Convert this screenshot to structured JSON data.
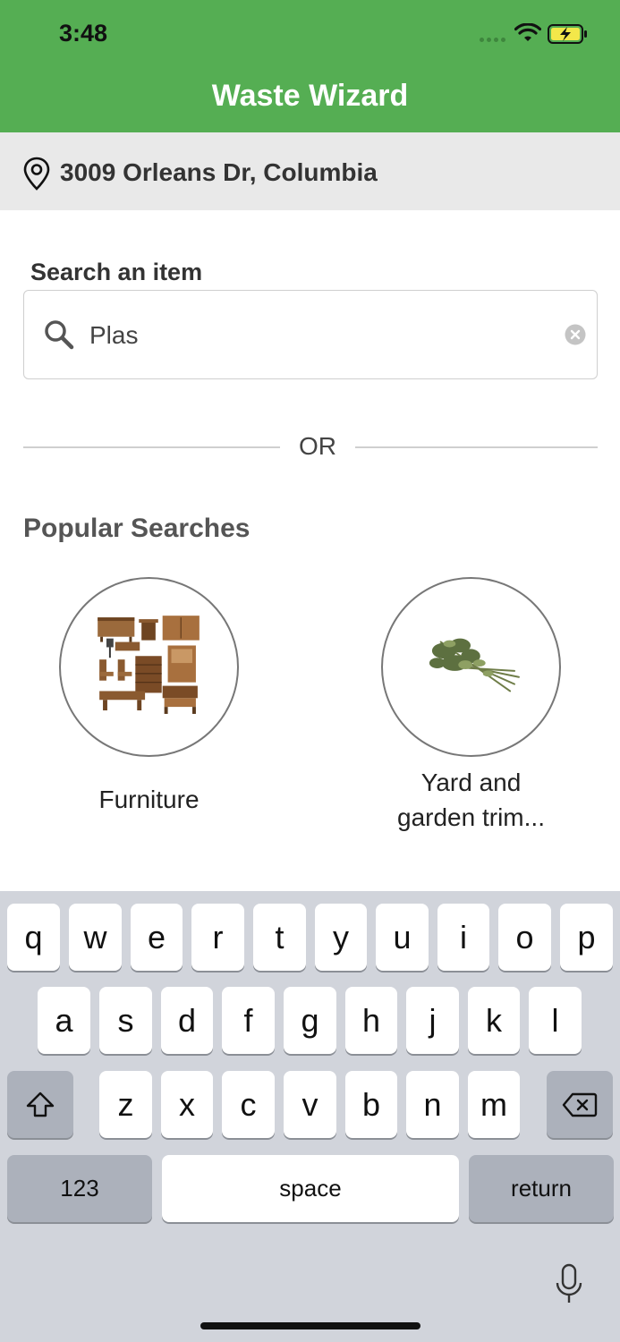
{
  "status_bar": {
    "time": "3:48"
  },
  "header": {
    "title": "Waste Wizard"
  },
  "location": {
    "address": "3009 Orleans Dr, Columbia"
  },
  "search": {
    "label": "Search an item",
    "value": "Plas"
  },
  "divider": {
    "text": "OR"
  },
  "popular": {
    "title": "Popular Searches",
    "items": [
      {
        "label": "Furniture",
        "icon": "furniture-image"
      },
      {
        "label": "Yard and garden trim...",
        "label_line1": "Yard and",
        "label_line2": "garden trim...",
        "icon": "yard-trimmings-image"
      }
    ]
  },
  "keyboard": {
    "row1": [
      "q",
      "w",
      "e",
      "r",
      "t",
      "y",
      "u",
      "i",
      "o",
      "p"
    ],
    "row2": [
      "a",
      "s",
      "d",
      "f",
      "g",
      "h",
      "j",
      "k",
      "l"
    ],
    "row3": [
      "z",
      "x",
      "c",
      "v",
      "b",
      "n",
      "m"
    ],
    "numbers_label": "123",
    "space_label": "space",
    "return_label": "return"
  },
  "colors": {
    "accent": "#55ae53",
    "location_bg": "#e9e9e9",
    "keyboard_bg": "#d1d4db"
  }
}
